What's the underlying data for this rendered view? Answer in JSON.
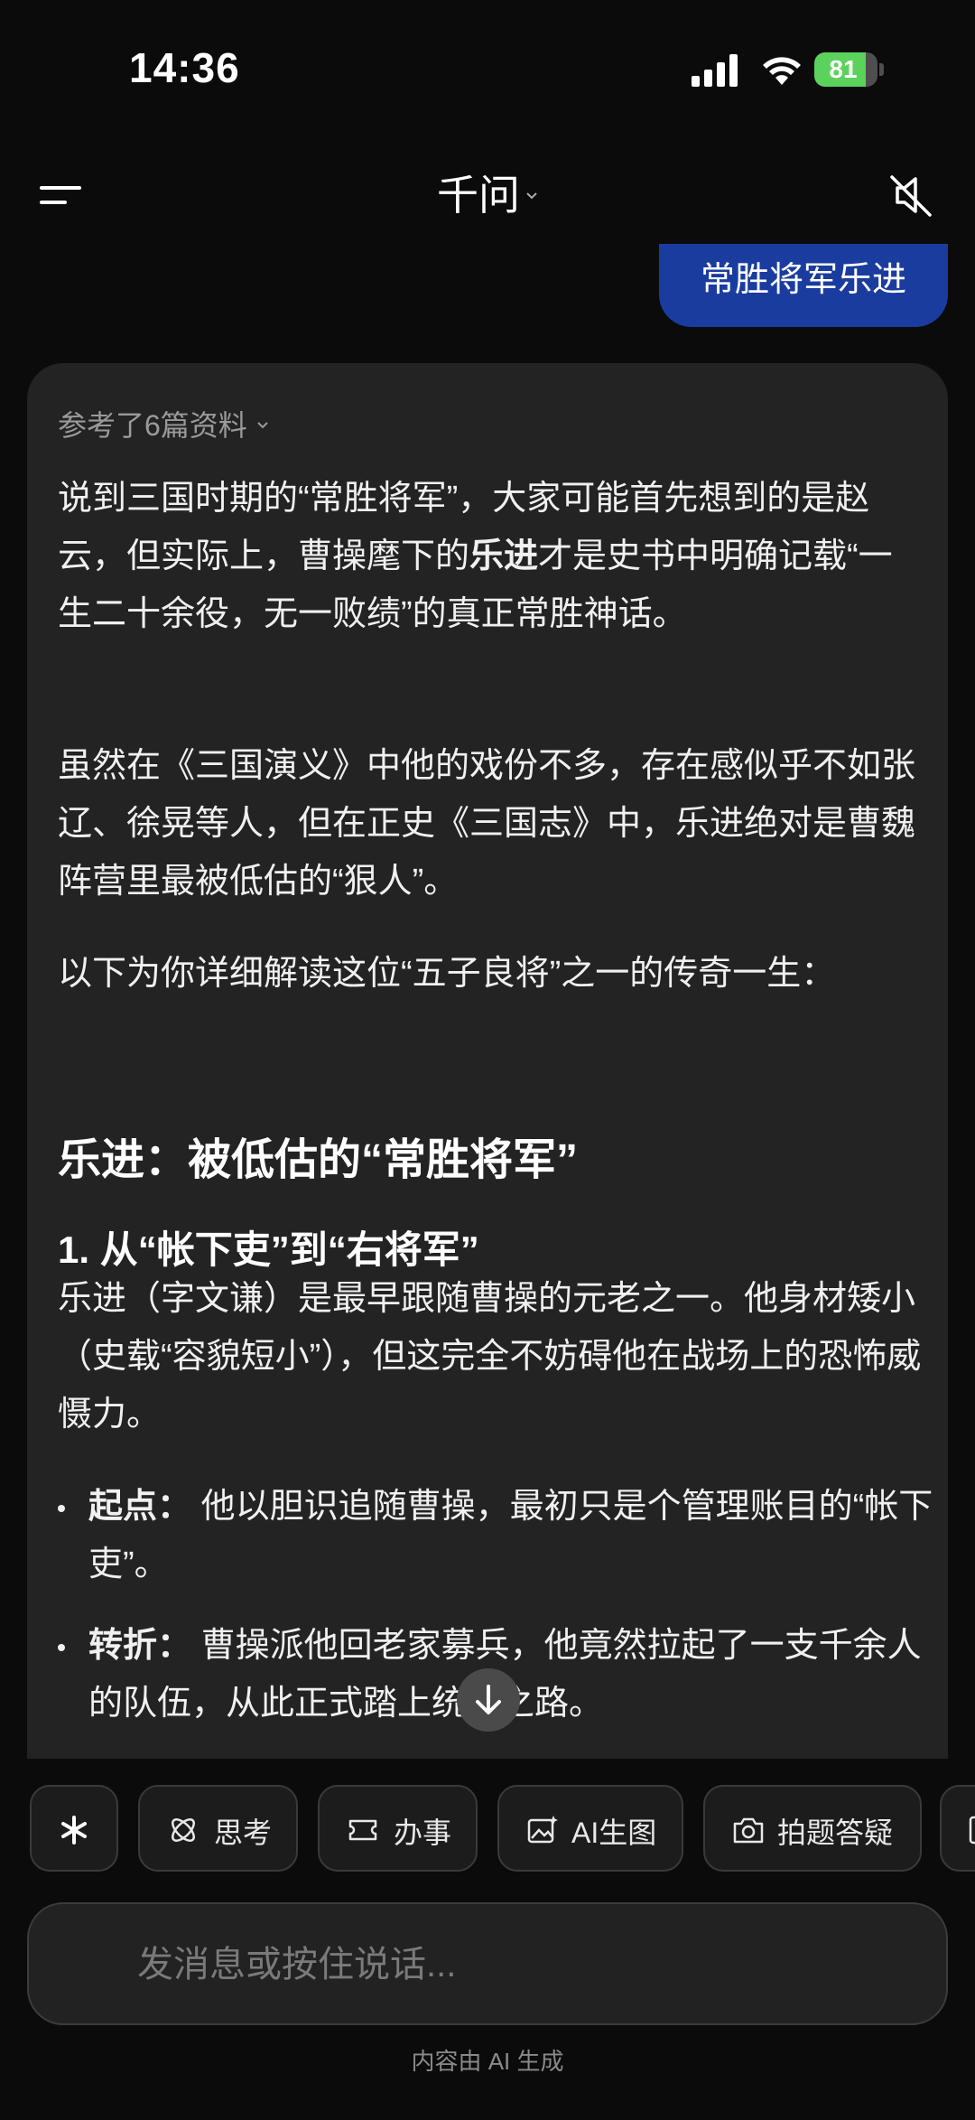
{
  "status": {
    "time": "14:36",
    "battery": "81",
    "battery_level": 0.81
  },
  "header": {
    "title": "千问"
  },
  "user_message": "常胜将军乐进",
  "answer": {
    "refs": "参考了6篇资料",
    "p1_a": "说到三国时期的“常胜将军”，大家可能首先想到的是赵云，但实际上，曹操麾下的",
    "p1_bold": "乐进",
    "p1_b": "才是史书中明确记载“一生二十余役，无一败绩”的真正常胜神话。",
    "p2": "虽然在《三国演义》中他的戏份不多，存在感似乎不如张辽、徐晃等人，但在正史《三国志》中，乐进绝对是曹魏阵营里最被低估的“狠人”。",
    "p3": "以下为你详细解读这位“五子良将”之一的传奇一生：",
    "h2": "乐进：被低估的“常胜将军”",
    "h3": "1. 从“帐下吏”到“右将军”",
    "p4": "乐进（字文谦）是最早跟随曹操的元老之一。他身材矮小（史载“容貌短小”），但这完全不妨碍他在战场上的恐怖威慑力。",
    "bullets": [
      {
        "label": "起点：",
        "text": " 他以胆识追随曹操，最初只是个管理账目的“帐下吏”。"
      },
      {
        "label": "转折：",
        "text": " 曹操派他回老家募兵，他竟然拉起了一支千余人的队伍，从此正式踏上统帅之路。"
      }
    ]
  },
  "chips": [
    "思考",
    "办事",
    "AI生图",
    "拍题答疑"
  ],
  "input": {
    "placeholder": "发消息或按住说话..."
  },
  "footer": "内容由 AI 生成",
  "colors": {
    "bubble": "#1b3c9f",
    "card": "#232323",
    "battery": "#5bd25b"
  }
}
